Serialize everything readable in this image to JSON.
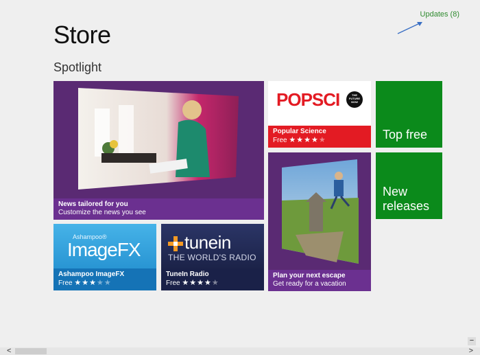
{
  "header": {
    "title": "Store",
    "section": "Spotlight",
    "updates_link": "Updates (8)"
  },
  "tiles": {
    "news": {
      "title": "News tailored for you",
      "subtitle": "Customize the news you see"
    },
    "popsci": {
      "logo": "POPSCI",
      "badge": "THE FUTURE NOW",
      "title": "Popular Science",
      "price": "Free",
      "rating": 4,
      "max_rating": 5
    },
    "top_free": {
      "label": "Top free"
    },
    "new_releases": {
      "label_line1": "New",
      "label_line2": "releases"
    },
    "escape": {
      "title": "Plan your next escape",
      "subtitle": "Get ready for a vacation"
    },
    "imagefx": {
      "brand": "Ashampoo®",
      "logo": "ImageFX",
      "title": "Ashampoo ImageFX",
      "price": "Free",
      "rating": 3,
      "max_rating": 5
    },
    "tunein": {
      "logo": "tunein",
      "tagline": "THE WORLD'S RADIO",
      "title": "TuneIn Radio",
      "price": "Free",
      "rating": 4,
      "max_rating": 5
    }
  },
  "scroll": {
    "left_arrow": "<",
    "right_arrow": ">",
    "zoom_button": "−"
  },
  "colors": {
    "accent_green": "#0b8a1b",
    "tile_purple": "#5a2a73",
    "popsci_red": "#e31b23",
    "imagefx_blue": "#1e8ed0",
    "tunein_navy": "#1a2148"
  }
}
